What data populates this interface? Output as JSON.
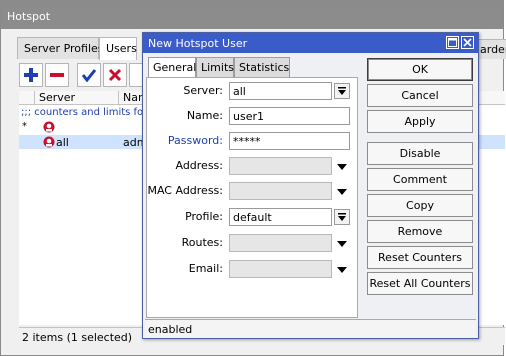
{
  "window": {
    "title": "Hotspot",
    "tabs": [
      "Server Profiles",
      "Users"
    ],
    "hidden_tab_fragment": "arden"
  },
  "list": {
    "columns": [
      "Server",
      "Nam"
    ],
    "comment": ";;; counters and limits fo",
    "rows": [
      {
        "marker": "*",
        "server": "",
        "name": ""
      },
      {
        "marker": "",
        "server": "all",
        "name": "adm"
      }
    ],
    "status": "2 items (1 selected)"
  },
  "dialog": {
    "title": "New Hotspot User",
    "tabs": [
      "General",
      "Limits",
      "Statistics"
    ],
    "fields": {
      "server": {
        "label": "Server:",
        "value": "all"
      },
      "name": {
        "label": "Name:",
        "value": "user1"
      },
      "password": {
        "label": "Password:",
        "value": "*****"
      },
      "address": {
        "label": "Address:",
        "value": ""
      },
      "mac": {
        "label": "MAC Address:",
        "value": ""
      },
      "profile": {
        "label": "Profile:",
        "value": "default"
      },
      "routes": {
        "label": "Routes:",
        "value": ""
      },
      "email": {
        "label": "Email:",
        "value": ""
      }
    },
    "buttons": [
      "OK",
      "Cancel",
      "Apply",
      "Disable",
      "Comment",
      "Copy",
      "Remove",
      "Reset Counters",
      "Reset All Counters"
    ],
    "status": "enabled"
  },
  "colors": {
    "accent": "#3a5cc9",
    "link_blue": "#1f3fb0",
    "selection": "#cfe3ff"
  }
}
